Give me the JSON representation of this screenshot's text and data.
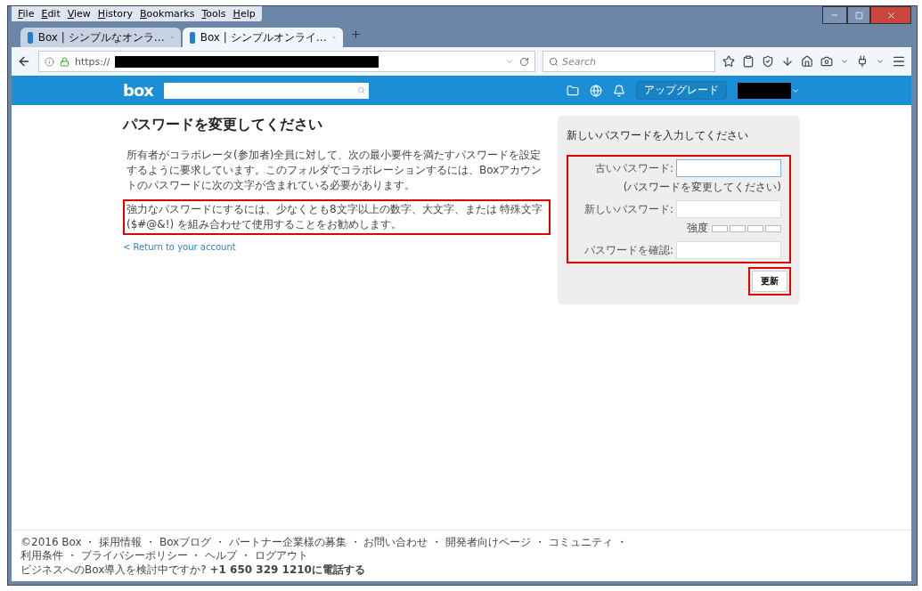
{
  "menu": [
    "File",
    "Edit",
    "View",
    "History",
    "Bookmarks",
    "Tools",
    "Help"
  ],
  "tabs": [
    {
      "label": "Box | シンプルなオンラ…",
      "selected": false
    },
    {
      "label": "Box | シンプルオンライ…",
      "selected": true
    }
  ],
  "address": {
    "prefix": "https://"
  },
  "search": {
    "placeholder": "Search"
  },
  "header": {
    "logo": "box",
    "upgrade": "アップグレード"
  },
  "main": {
    "title": "パスワードを変更してください",
    "paragraphs": [
      {
        "text": "所有者がコラボレータ(参加者)全員に対して、次の最小要件を満たすパスワードを設定するように要求しています。このフォルダでコラボレーションするには、Boxアカウントのパスワードに次の文字が含まれている必要があります。",
        "highlighted": false
      },
      {
        "text": "強力なパスワードにするには、少なくとも8文字以上の数字、大文字、または 特殊文字 ($#@&!) を組み合わせて使用することをお勧めします。",
        "highlighted": true
      }
    ],
    "link": "< Return to your account"
  },
  "form": {
    "title": "新しいパスワードを入力してください",
    "highlighted": true,
    "fields": [
      {
        "kind": "old",
        "label": "古いパスワード:",
        "hint": "(パスワードを変更してください)",
        "focused": true
      },
      {
        "kind": "strength",
        "label": "新しいパスワード:",
        "strength_label": "強度",
        "focused": false
      },
      {
        "kind": "plain",
        "label": "パスワードを確認:",
        "focused": false
      }
    ],
    "button": "更新",
    "button_highlighted": true
  },
  "footer": {
    "lines": [
      "©2016 Box ・ 採用情報 ・ Boxブログ ・ パートナー企業様の募集 ・ お問い合わせ ・ 開発者向けページ ・ コミュニティ ・",
      "利用条件 ・ プライバシーポリシー ・ ヘルプ ・ ログアウト"
    ],
    "contact": "ビジネスへのBox導入を検討中ですか? **+1 650 329 1210に電話する**"
  }
}
